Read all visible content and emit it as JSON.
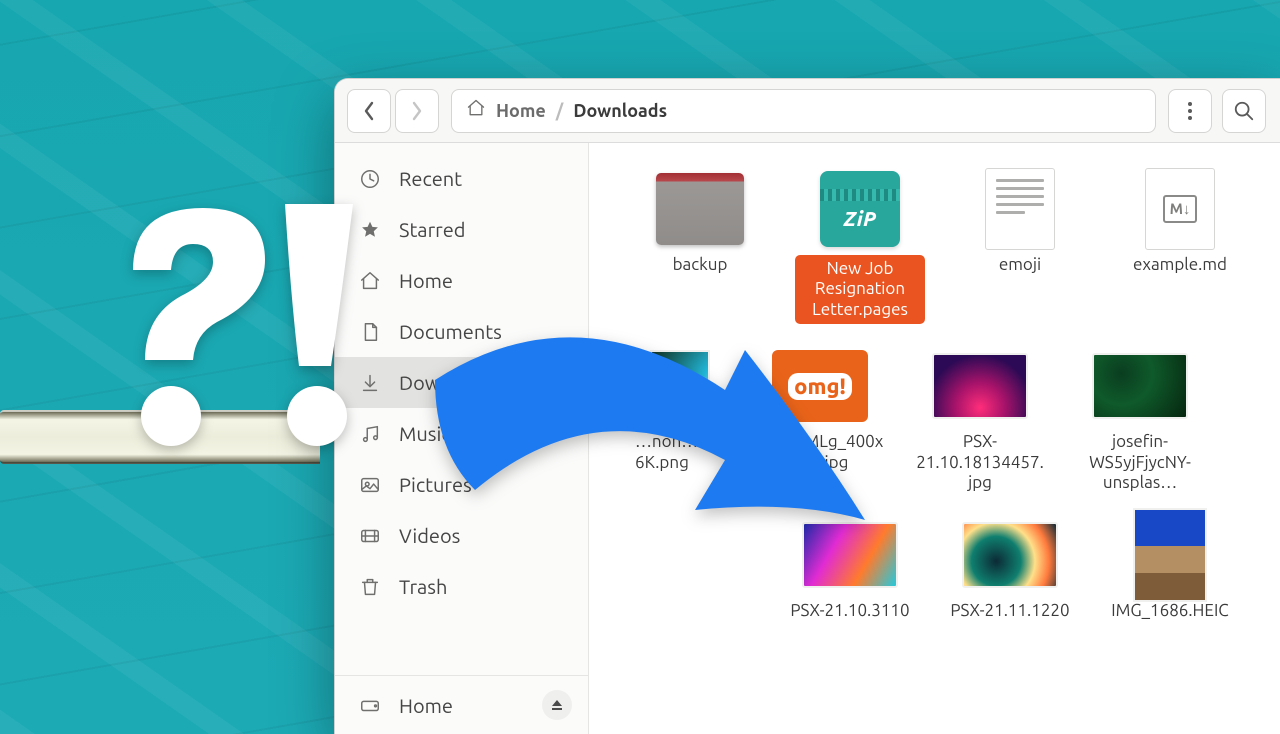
{
  "breadcrumb": {
    "root": "Home",
    "current": "Downloads",
    "separator": "/"
  },
  "toolbar": {
    "back": "‹",
    "forward": "›"
  },
  "sidebar": {
    "items": [
      {
        "label": "Recent",
        "icon": "clock-icon"
      },
      {
        "label": "Starred",
        "icon": "star-icon"
      },
      {
        "label": "Home",
        "icon": "home-icon"
      },
      {
        "label": "Documents",
        "icon": "document-icon"
      },
      {
        "label": "Downloads",
        "icon": "download-icon",
        "active": true
      },
      {
        "label": "Music",
        "icon": "music-icon"
      },
      {
        "label": "Pictures",
        "icon": "pictures-icon"
      },
      {
        "label": "Videos",
        "icon": "videos-icon"
      },
      {
        "label": "Trash",
        "icon": "trash-icon"
      }
    ],
    "places": [
      {
        "label": "Home",
        "icon": "disk-icon"
      }
    ]
  },
  "files": {
    "row1": [
      {
        "name": "backup",
        "kind": "folder"
      },
      {
        "name": "New Job Resignation Letter.pages",
        "kind": "zip",
        "zip_label": "ZiP",
        "selected": true
      },
      {
        "name": "emoji",
        "kind": "doc"
      },
      {
        "name": "example.md",
        "kind": "md",
        "md_badge": "M↓"
      }
    ],
    "row2": [
      {
        "name": "…non…6K.png",
        "kind": "half"
      },
      {
        "name": "wqczFMLg_400x400.jpg",
        "kind": "omg",
        "omg_text": "omg!"
      },
      {
        "name": "PSX-21.10.18134457.jpg",
        "kind": "img",
        "variant": "sunset"
      },
      {
        "name": "josefin-WS5yjFjycNY-unsplas…",
        "kind": "img",
        "variant": "leaves"
      }
    ],
    "row3": [
      {
        "name": "PSX-21.10.3110",
        "kind": "img",
        "variant": "abstract1"
      },
      {
        "name": "PSX-21.11.1220",
        "kind": "img",
        "variant": "abstract2"
      },
      {
        "name": "IMG_1686.HEIC",
        "kind": "cat"
      }
    ]
  },
  "overlay": {
    "punctuation": "?!"
  },
  "colors": {
    "accent": "#e95420",
    "arrow": "#1e7af0",
    "teal": "#1aa7b0"
  }
}
